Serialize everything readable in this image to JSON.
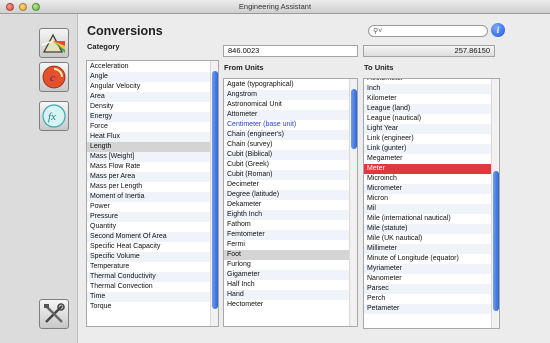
{
  "window": {
    "title": "Engineering Assistant"
  },
  "sidebar": {
    "buttons": [
      {
        "label": "Charts",
        "icon": "prism-icon"
      },
      {
        "label": "Conversions",
        "icon": "conversion-icon"
      },
      {
        "label": "Functions",
        "icon": "function-icon"
      },
      {
        "label": "Settings",
        "icon": "tools-icon"
      }
    ]
  },
  "header": {
    "title": "Conversions"
  },
  "search": {
    "placeholder": "",
    "value": ""
  },
  "category": {
    "label": "Category",
    "items": [
      "Acceleration",
      "Angle",
      "Angular Velocity",
      "Area",
      "Density",
      "Energy",
      "Force",
      "Heat Flux",
      "Length",
      "Mass [Weight]",
      "Mass Flow Rate",
      "Mass per Area",
      "Mass per Length",
      "Moment of Inertia",
      "Power",
      "Pressure",
      "Quantity",
      "Second Moment Of Area",
      "Specific Heat Capacity",
      "Specific Volume",
      "Temperature",
      "Thermal Conductivity",
      "Thermal Convection",
      "Time",
      "Torque"
    ],
    "selected": "Length"
  },
  "from": {
    "label": "From Units",
    "value": "846.0023",
    "items": [
      "Agate (typographical)",
      "Angstrom",
      "Astronomical Unit",
      "Attometer",
      "Centimeter (base unit)",
      "Chain (engineer's)",
      "Chain (survey)",
      "Cubit (Biblical)",
      "Cubit (Greek)",
      "Cubit (Roman)",
      "Decimeter",
      "Degree (latitude)",
      "Dekameter",
      "Eighth Inch",
      "Fathom",
      "Femtometer",
      "Fermi",
      "Foot",
      "Furlong",
      "Gigameter",
      "Half Inch",
      "Hand",
      "Hectometer"
    ],
    "selected": "Foot",
    "base_unit": "Centimeter (base unit)"
  },
  "to": {
    "label": "To Units",
    "value": "257.86150",
    "items": [
      "Hectometer",
      "Inch",
      "Kilometer",
      "League (land)",
      "League (nautical)",
      "Light Year",
      "Link (engineer)",
      "Link (gunter)",
      "Megameter",
      "Meter",
      "Microinch",
      "Micrometer",
      "Micron",
      "Mil",
      "Mile (international nautical)",
      "Mile (statute)",
      "Mile (UK nautical)",
      "Millimeter",
      "Minute of Longitude (equator)",
      "Myriameter",
      "Nanometer",
      "Parsec",
      "Perch",
      "Petameter"
    ],
    "selected": "Meter"
  },
  "colors": {
    "selection_red": "#e0393d",
    "scroll_blue": "#2d65d4",
    "base_unit_blue": "#2a3fcf"
  }
}
